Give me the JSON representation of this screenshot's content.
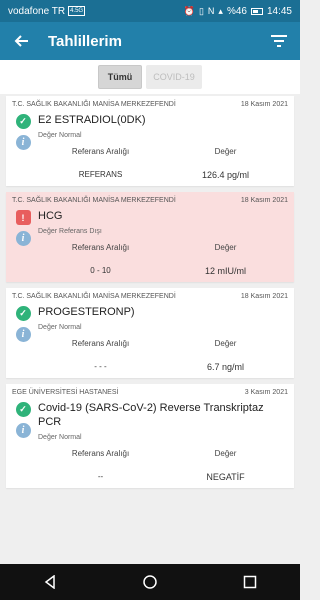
{
  "status_bar": {
    "carrier": "vodafone TR",
    "network_badge": "4.5G",
    "battery_percent": "%46",
    "time": "14:45",
    "icons": [
      "alarm-icon",
      "vibrate-icon",
      "nfc-icon",
      "signal-icon",
      "battery-icon"
    ]
  },
  "app_bar": {
    "title": "Tahlillerim",
    "back_icon": "arrow-left-icon",
    "filter_icon": "filter-icon"
  },
  "tabs": [
    {
      "label": "Tümü",
      "active": true
    },
    {
      "label": "COVID-19",
      "active": false
    }
  ],
  "labels": {
    "reference_range": "Referans Aralığı",
    "value": "Değer"
  },
  "cards": [
    {
      "hospital": "T.C. SAĞLIK BAKANLIĞI MANİSA MERKEZEFENDİ",
      "date": "18 Kasım 2021",
      "test": "E2 ESTRADIOL(0DK)",
      "status": "Değer Normal",
      "reference": "REFERANS",
      "value": "126.4 pg/ml",
      "state": "normal"
    },
    {
      "hospital": "T.C. SAĞLIK BAKANLIĞI MANİSA MERKEZEFENDİ",
      "date": "18 Kasım 2021",
      "test": "HCG",
      "status": "Değer Referans Dışı",
      "reference": "0 - 10",
      "value": "12 mIU/ml",
      "state": "alert"
    },
    {
      "hospital": "T.C. SAĞLIK BAKANLIĞI MANİSA MERKEZEFENDİ",
      "date": "18 Kasım 2021",
      "test": "PROGESTERONP)",
      "status": "Değer Normal",
      "reference": "- - -",
      "value": "6.7 ng/ml",
      "state": "normal"
    },
    {
      "hospital": "EGE ÜNİVERSİTESİ HASTANESİ",
      "date": "3 Kasım 2021",
      "test": "Covid-19 (SARS-CoV-2) Reverse Transkriptaz PCR",
      "status": "Değer Normal",
      "reference": "--",
      "value": "NEGATİF",
      "state": "normal"
    }
  ],
  "nav_bar": {
    "icons": [
      "back-triangle-icon",
      "home-circle-icon",
      "recents-square-icon"
    ]
  },
  "colors": {
    "status_bar": "#1b6f94",
    "app_bar": "#2280aa",
    "ok": "#2fb37a",
    "warn": "#e85d5d",
    "alert_bg": "#fadede"
  }
}
